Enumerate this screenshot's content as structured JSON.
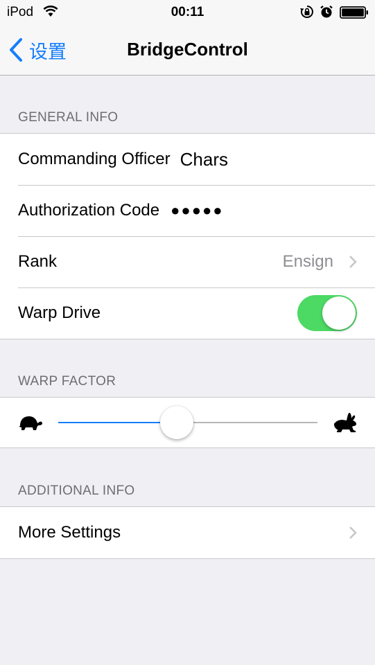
{
  "status_bar": {
    "carrier": "iPod",
    "time": "00:11",
    "icons": [
      "wifi-icon",
      "orientation-lock-icon",
      "alarm-icon",
      "battery-icon"
    ]
  },
  "nav": {
    "back_label": "设置",
    "title": "BridgeControl"
  },
  "sections": {
    "general_info": {
      "header": "GENERAL INFO",
      "commanding_officer": {
        "label": "Commanding Officer",
        "value": "Chars"
      },
      "authorization_code": {
        "label": "Authorization Code",
        "value": "●●●●●"
      },
      "rank": {
        "label": "Rank",
        "value": "Ensign"
      },
      "warp_drive": {
        "label": "Warp Drive",
        "on": true
      }
    },
    "warp_factor": {
      "header": "WARP FACTOR",
      "slider_value": 0.45,
      "min_icon": "turtle-icon",
      "max_icon": "rabbit-icon"
    },
    "additional_info": {
      "header": "ADDITIONAL INFO",
      "more_settings": {
        "label": "More Settings"
      }
    }
  },
  "colors": {
    "accent": "#157efb",
    "toggle_on": "#4cd964",
    "background": "#efeff4",
    "secondary_text": "#8e8e93"
  }
}
